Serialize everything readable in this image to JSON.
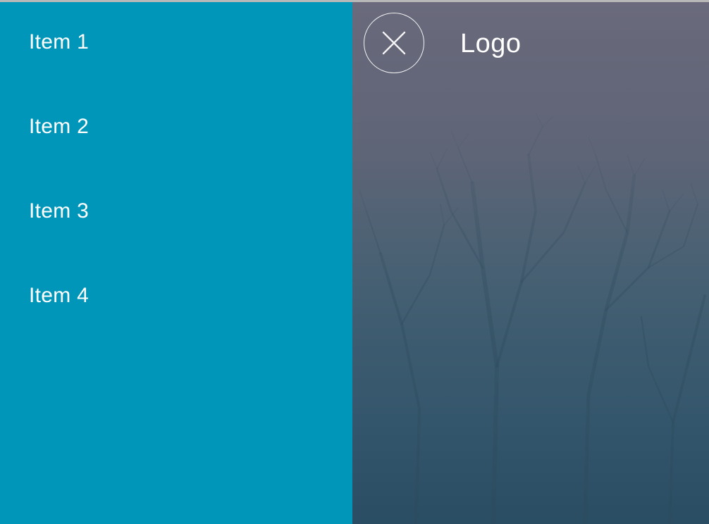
{
  "nav": {
    "items": [
      {
        "label": "Item 1"
      },
      {
        "label": "Item 2"
      },
      {
        "label": "Item 3"
      },
      {
        "label": "Item 4"
      }
    ]
  },
  "header": {
    "logo_text": "Logo",
    "close_icon": "close-icon"
  },
  "colors": {
    "drawer_bg": "#0096b9",
    "text": "#ffffff",
    "backdrop_top": "#646374",
    "backdrop_bottom": "#2a4d63"
  }
}
